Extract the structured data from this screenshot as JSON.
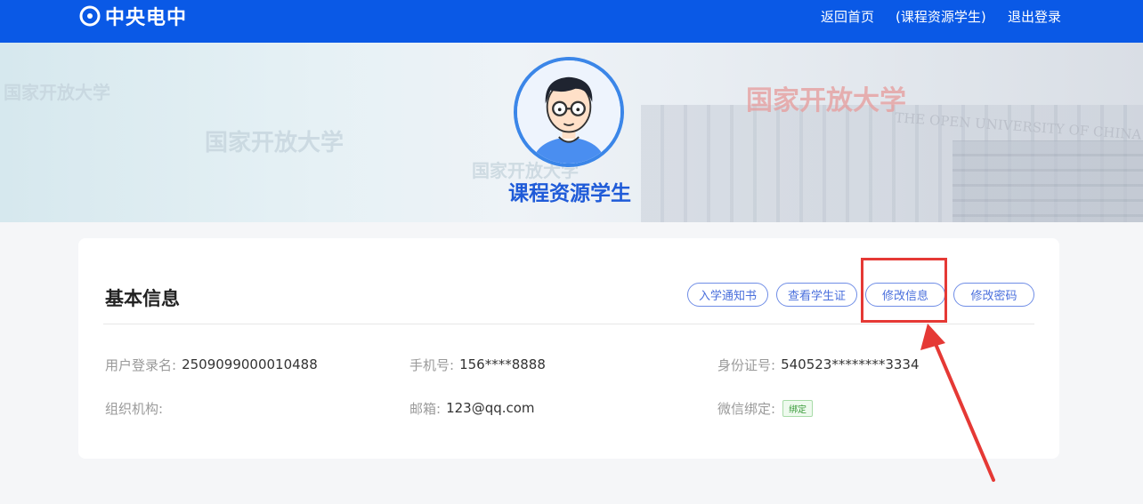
{
  "header": {
    "logo_text": "中央电中",
    "nav": {
      "home": "返回首页",
      "user": "(课程资源学生)",
      "logout": "退出登录"
    }
  },
  "banner": {
    "watermark_left": "国家开放大学",
    "watermark_mid1": "国家开放大学",
    "watermark_mid2": "国家开放大学",
    "watermark_red": "国家开放大学",
    "watermark_en": "THE OPEN UNIVERSITY OF CHINA",
    "username": "课程资源学生"
  },
  "info": {
    "title": "基本信息",
    "buttons": {
      "admission": "入学通知书",
      "student_card": "查看学生证",
      "edit_info": "修改信息",
      "change_password": "修改密码"
    },
    "fields": {
      "login_label": "用户登录名:",
      "login_value": "2509099000010488",
      "phone_label": "手机号:",
      "phone_value": "156****8888",
      "id_label": "身份证号:",
      "id_value": "540523********3334",
      "org_label": "组织机构:",
      "org_value": "",
      "email_label": "邮箱:",
      "email_value": "123@qq.com",
      "wechat_label": "微信绑定:",
      "wechat_badge": "绑定"
    }
  },
  "colors": {
    "header_bg": "#0a59e6",
    "accent": "#4a6fdc",
    "highlight": "#e53935"
  }
}
